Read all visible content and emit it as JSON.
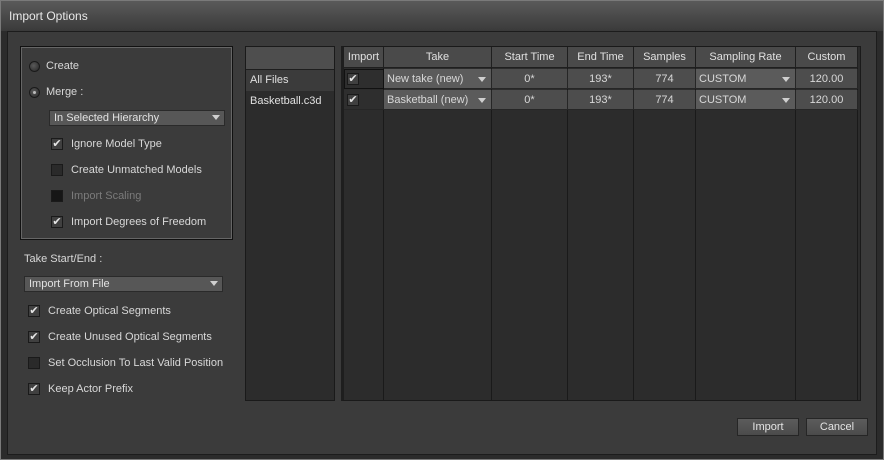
{
  "window": {
    "title": "Import Options"
  },
  "options": {
    "create_label": "Create",
    "merge_label": "Merge :",
    "hierarchy_value": "In Selected Hierarchy",
    "ignore_model_type": "Ignore Model Type",
    "create_unmatched": "Create Unmatched Models",
    "import_scaling": "Import Scaling",
    "import_dof": "Import Degrees of Freedom",
    "take_start_end_label": "Take Start/End :",
    "take_start_end_value": "Import From File",
    "create_optical": "Create Optical Segments",
    "create_unused_optical": "Create Unused Optical Segments",
    "set_occlusion": "Set Occlusion To Last Valid Position",
    "keep_actor_prefix": "Keep Actor Prefix"
  },
  "files": [
    "All Files",
    "Basketball.c3d"
  ],
  "table": {
    "headers": [
      "Import",
      "Take",
      "Start Time",
      "End Time",
      "Samples",
      "Sampling Rate",
      "Custom"
    ],
    "rows": [
      {
        "take": "New take (new)",
        "start": "0*",
        "end": "193*",
        "samples": "774",
        "rate": "CUSTOM",
        "custom": "120.00"
      },
      {
        "take": "Basketball (new)",
        "start": "0*",
        "end": "193*",
        "samples": "774",
        "rate": "CUSTOM",
        "custom": "120.00"
      }
    ]
  },
  "buttons": {
    "import": "Import",
    "cancel": "Cancel"
  },
  "check_glyph": "✔"
}
